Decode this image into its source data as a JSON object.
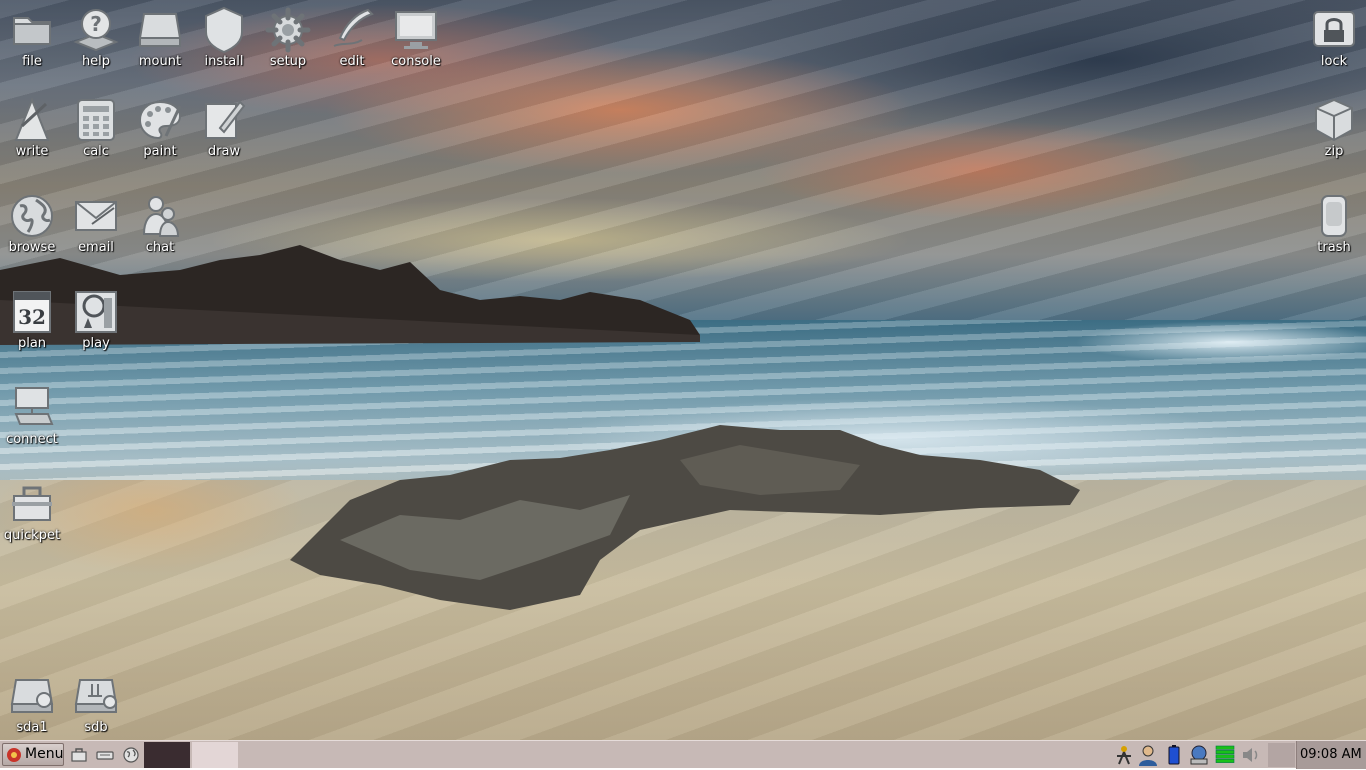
{
  "desktop": {
    "left_icons": [
      {
        "id": "file",
        "label": "file",
        "icon": "folder-icon"
      },
      {
        "id": "help",
        "label": "help",
        "icon": "help-icon"
      },
      {
        "id": "mount",
        "label": "mount",
        "icon": "drive-icon"
      },
      {
        "id": "install",
        "label": "install",
        "icon": "shield-icon"
      },
      {
        "id": "setup",
        "label": "setup",
        "icon": "gear-icon"
      },
      {
        "id": "edit",
        "label": "edit",
        "icon": "quill-icon"
      },
      {
        "id": "console",
        "label": "console",
        "icon": "monitor-icon"
      },
      {
        "id": "write",
        "label": "write",
        "icon": "pen-icon"
      },
      {
        "id": "calc",
        "label": "calc",
        "icon": "calculator-icon"
      },
      {
        "id": "paint",
        "label": "paint",
        "icon": "palette-icon"
      },
      {
        "id": "draw",
        "label": "draw",
        "icon": "draw-icon"
      },
      {
        "id": "browse",
        "label": "browse",
        "icon": "globe-icon"
      },
      {
        "id": "email",
        "label": "email",
        "icon": "envelope-icon"
      },
      {
        "id": "chat",
        "label": "chat",
        "icon": "chat-people-icon"
      },
      {
        "id": "plan",
        "label": "plan",
        "icon": "calendar-icon",
        "calendar_day": "32"
      },
      {
        "id": "play",
        "label": "play",
        "icon": "media-icon"
      },
      {
        "id": "connect",
        "label": "connect",
        "icon": "network-icon"
      },
      {
        "id": "quickpet",
        "label": "quickpet",
        "icon": "toolbox-icon"
      },
      {
        "id": "sda1",
        "label": "sda1",
        "icon": "drive-gear-icon"
      },
      {
        "id": "sdb",
        "label": "sdb",
        "icon": "usb-drive-icon"
      }
    ],
    "right_icons": [
      {
        "id": "lock",
        "label": "lock",
        "icon": "lock-icon"
      },
      {
        "id": "zip",
        "label": "zip",
        "icon": "box-icon"
      },
      {
        "id": "trash",
        "label": "trash",
        "icon": "trash-icon"
      }
    ]
  },
  "taskbar": {
    "menu_label": "Menu",
    "clock": "09:08 AM",
    "colors": {
      "bar": "#c7b9b6",
      "active_task": "#3a2c30",
      "inactive_task": "#e3d6d6"
    }
  }
}
